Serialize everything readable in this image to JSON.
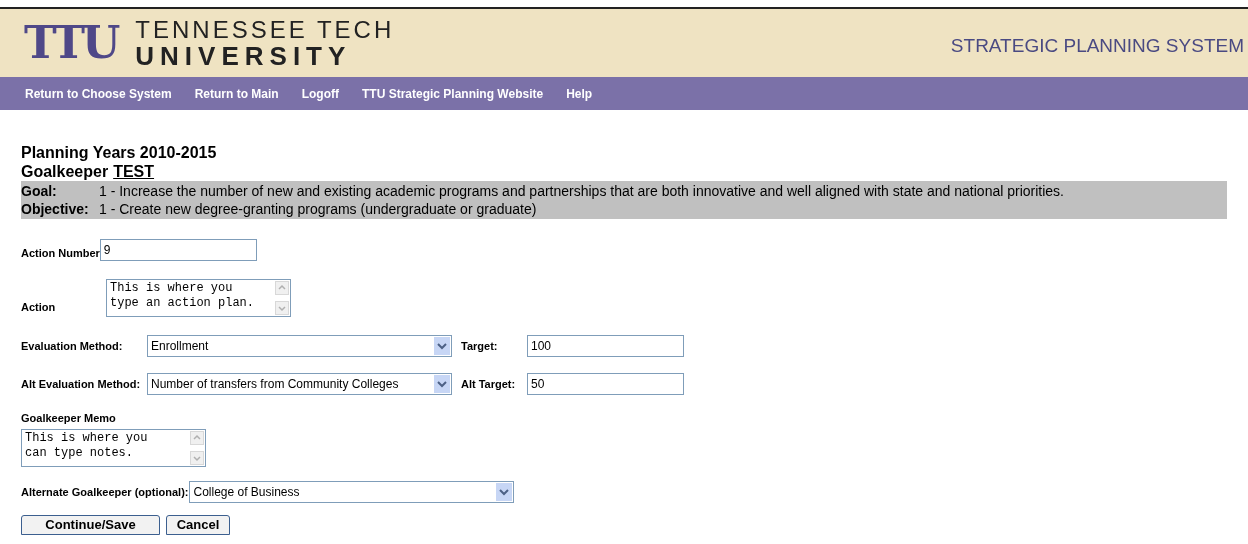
{
  "header": {
    "logo_mark": "TTU",
    "logo_line1": "TENNESSEE TECH",
    "logo_line2": "UNIVERSITY",
    "system_title": "STRATEGIC PLANNING SYSTEM"
  },
  "nav": [
    "Return to Choose System",
    "Return to Main",
    "Logoff",
    "TTU Strategic Planning Website",
    "Help"
  ],
  "planning_years": "Planning Years 2010-2015",
  "goalkeeper": {
    "label": "Goalkeeper",
    "value": "TEST"
  },
  "goal": {
    "label": "Goal:",
    "text": "1 - Increase the number of new and existing academic programs and partnerships that are both innovative and well aligned with state and national priorities."
  },
  "objective": {
    "label": "Objective:",
    "text": "1 - Create new degree-granting programs (undergraduate or graduate)"
  },
  "form": {
    "action_number": {
      "label": "Action Number",
      "value": "9"
    },
    "action": {
      "label": "Action",
      "value": "This is where you\ntype an action plan."
    },
    "evaluation_method": {
      "label": "Evaluation Method:",
      "value": "Enrollment"
    },
    "target": {
      "label": "Target:",
      "value": "100"
    },
    "alt_evaluation_method": {
      "label": "Alt Evaluation Method:",
      "value": "Number of transfers from Community Colleges"
    },
    "alt_target": {
      "label": "Alt Target:",
      "value": "50"
    },
    "goalkeeper_memo": {
      "label": "Goalkeeper Memo",
      "value": "This is where you\ncan type notes."
    },
    "alternate_goalkeeper": {
      "label": "Alternate Goalkeeper (optional):",
      "value": "College of Business"
    }
  },
  "buttons": [
    "Continue/Save",
    "Cancel"
  ]
}
